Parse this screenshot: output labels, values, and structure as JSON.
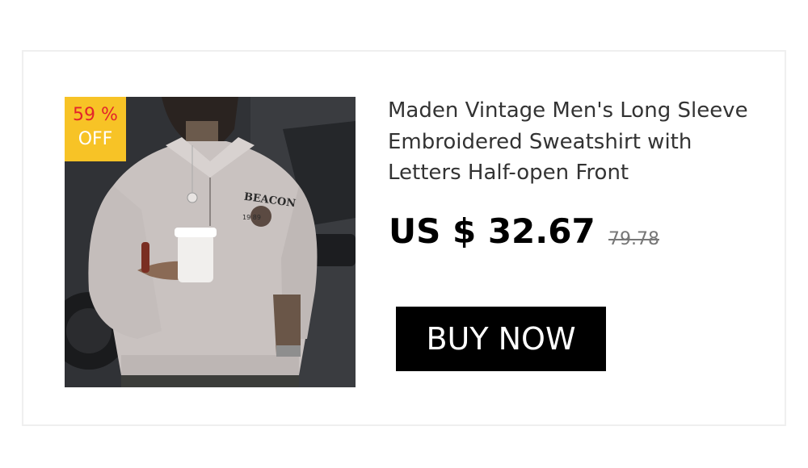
{
  "product": {
    "title": "Maden Vintage Men's Long Sleeve Embroidered Sweatshirt with Letters Half-open Front",
    "discount": {
      "percent": "59 %",
      "off": "OFF"
    },
    "price": {
      "current": "US $ 32.67",
      "original": "79.78"
    },
    "image": {
      "embroidery_text": "BEACON",
      "embroidery_number": "19 89"
    }
  },
  "actions": {
    "buy_label": "BUY NOW"
  },
  "colors": {
    "badge_bg": "#f7c326",
    "badge_percent": "#e3242b",
    "button_bg": "#000000",
    "button_text": "#ffffff"
  }
}
